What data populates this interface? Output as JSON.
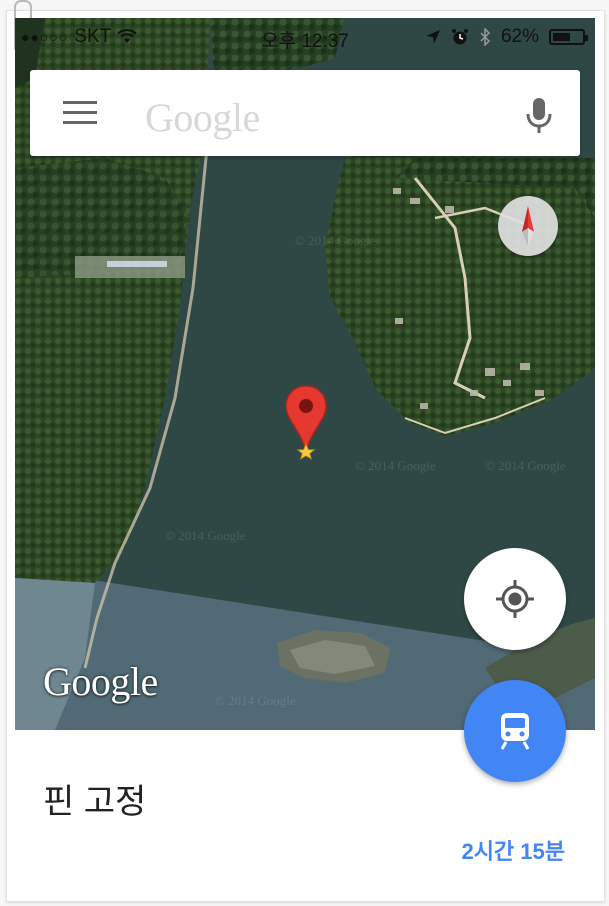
{
  "status_bar": {
    "signal_dots": "●●○○○",
    "carrier": "SKT",
    "time": "오후 12:37",
    "battery": "62%",
    "battery_fraction": 0.62
  },
  "search": {
    "placeholder": "Google",
    "menu_icon": "hamburger-icon",
    "mic_icon": "microphone-icon"
  },
  "map": {
    "type": "satellite",
    "compass_icon": "compass-icon",
    "pin_icon": "map-pin-icon",
    "watermark": "© 2014 Google",
    "logo": "Google"
  },
  "controls": {
    "my_location_icon": "crosshair-icon",
    "transit_icon": "train-icon"
  },
  "panel": {
    "title": "핀 고정",
    "eta": "2시간 15분"
  },
  "colors": {
    "accent": "#4285f4",
    "pin": "#e5392f",
    "water": "#2f4846"
  }
}
